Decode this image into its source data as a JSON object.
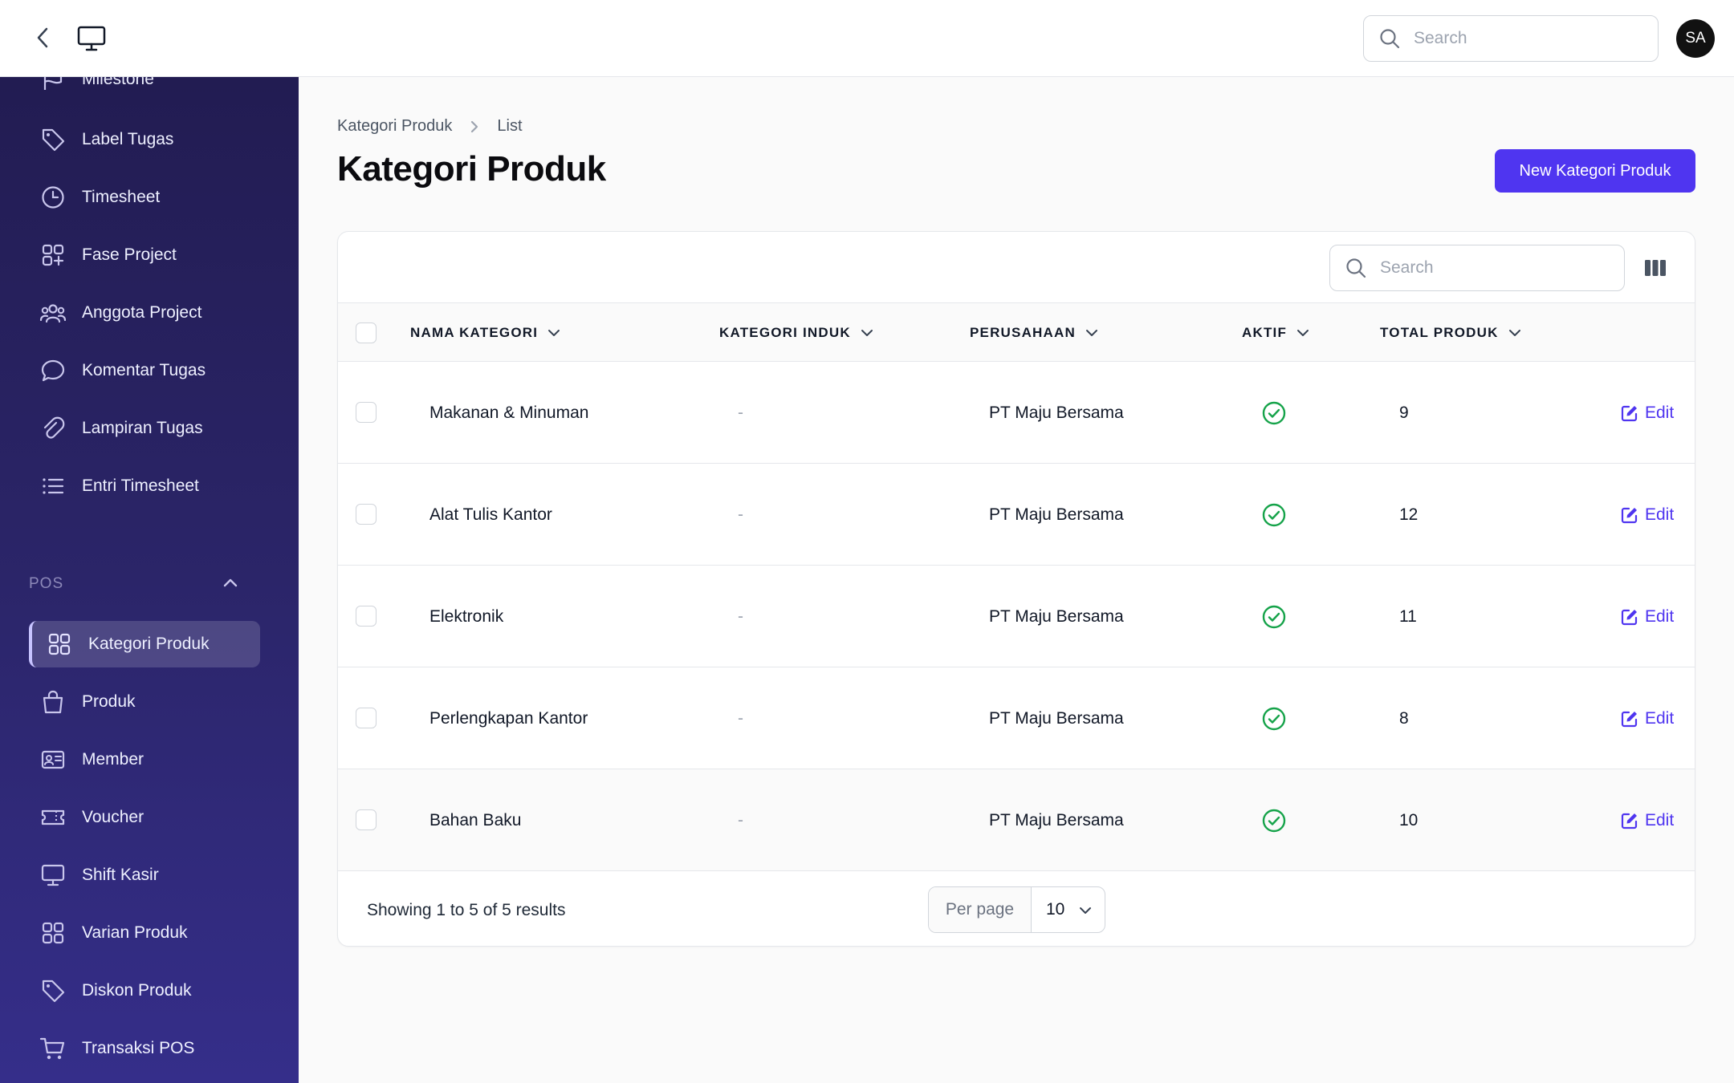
{
  "topbar": {
    "search_placeholder": "Search",
    "avatar_initials": "SA"
  },
  "sidebar": {
    "items_top": [
      {
        "label": "Milestone",
        "icon": "flag-icon"
      },
      {
        "label": "Label Tugas",
        "icon": "tag-icon"
      },
      {
        "label": "Timesheet",
        "icon": "clock-icon"
      },
      {
        "label": "Fase Project",
        "icon": "squares-plus-icon"
      },
      {
        "label": "Anggota Project",
        "icon": "user-group-icon"
      },
      {
        "label": "Komentar Tugas",
        "icon": "chat-bubble-icon"
      },
      {
        "label": "Lampiran Tugas",
        "icon": "paperclip-icon"
      },
      {
        "label": "Entri Timesheet",
        "icon": "list-icon"
      }
    ],
    "section_label": "POS",
    "items_pos": [
      {
        "label": "Kategori Produk",
        "icon": "squares-icon",
        "active": true
      },
      {
        "label": "Produk",
        "icon": "shopping-bag-icon"
      },
      {
        "label": "Member",
        "icon": "id-card-icon"
      },
      {
        "label": "Voucher",
        "icon": "ticket-icon"
      },
      {
        "label": "Shift Kasir",
        "icon": "computer-icon"
      },
      {
        "label": "Varian Produk",
        "icon": "squares-icon"
      },
      {
        "label": "Diskon Produk",
        "icon": "tag-icon"
      },
      {
        "label": "Transaksi POS",
        "icon": "cart-icon"
      }
    ]
  },
  "breadcrumb": {
    "parent": "Kategori Produk",
    "current": "List"
  },
  "page": {
    "title": "Kategori Produk",
    "new_button_label": "New Kategori Produk"
  },
  "table": {
    "search_placeholder": "Search",
    "columns": [
      "NAMA KATEGORI",
      "KATEGORI INDUK",
      "PERUSAHAAN",
      "AKTIF",
      "TOTAL PRODUK"
    ],
    "edit_label": "Edit",
    "rows": [
      {
        "nama": "Makanan & Minuman",
        "induk": "-",
        "perusahaan": "PT Maju Bersama",
        "aktif": true,
        "total": "9"
      },
      {
        "nama": "Alat Tulis Kantor",
        "induk": "-",
        "perusahaan": "PT Maju Bersama",
        "aktif": true,
        "total": "12"
      },
      {
        "nama": "Elektronik",
        "induk": "-",
        "perusahaan": "PT Maju Bersama",
        "aktif": true,
        "total": "11"
      },
      {
        "nama": "Perlengkapan Kantor",
        "induk": "-",
        "perusahaan": "PT Maju Bersama",
        "aktif": true,
        "total": "8"
      },
      {
        "nama": "Bahan Baku",
        "induk": "-",
        "perusahaan": "PT Maju Bersama",
        "aktif": true,
        "total": "10"
      }
    ],
    "showing_text": "Showing 1 to 5 of 5 results",
    "per_page_label": "Per page",
    "per_page_value": "10"
  },
  "colors": {
    "accent": "#4f35f0",
    "success": "#16a34a",
    "sidebar_top": "#221c52",
    "sidebar_bottom": "#352e8a"
  }
}
